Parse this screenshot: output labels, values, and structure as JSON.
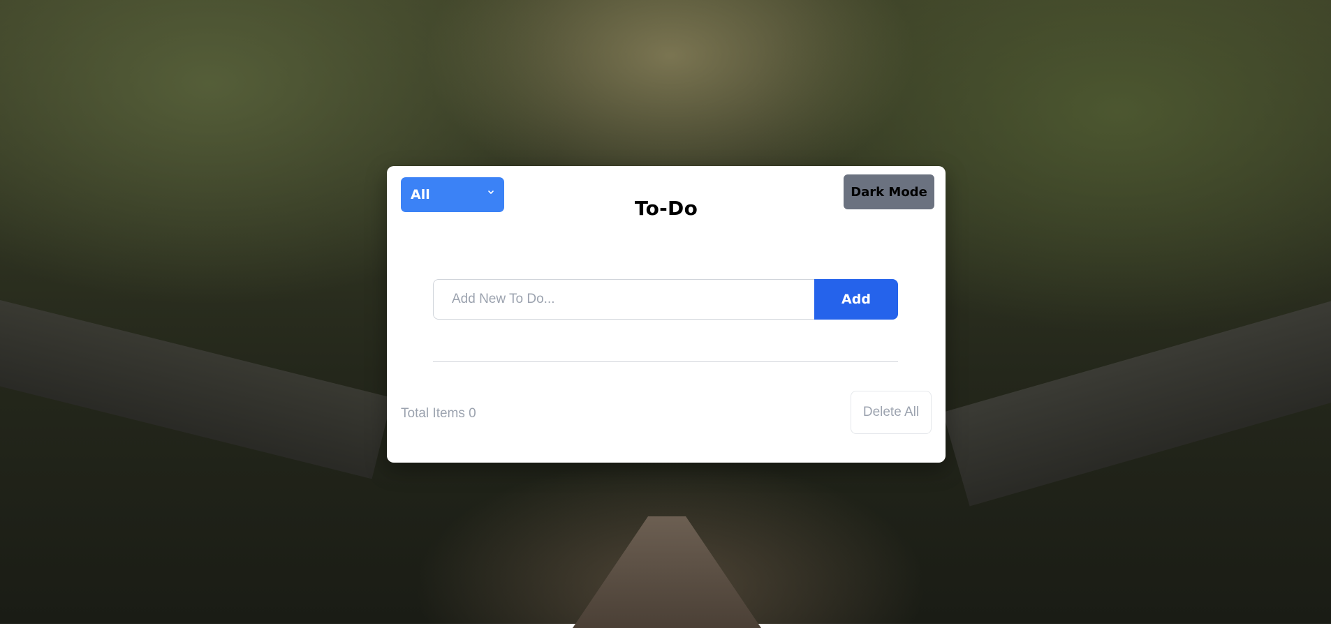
{
  "app": {
    "title": "To-Do"
  },
  "filter": {
    "selected": "All",
    "icon": "chevron-down-icon"
  },
  "theme_toggle": {
    "label": "Dark Mode"
  },
  "new_todo": {
    "placeholder": "Add New To Do...",
    "value": "",
    "add_label": "Add"
  },
  "footer": {
    "total_label": "Total Items 0",
    "delete_all_label": "Delete All"
  },
  "colors": {
    "primary": "#3b82f6",
    "add_button": "#2563eb",
    "dark_mode_button": "#6b7280",
    "muted_text": "#9ca3af"
  }
}
